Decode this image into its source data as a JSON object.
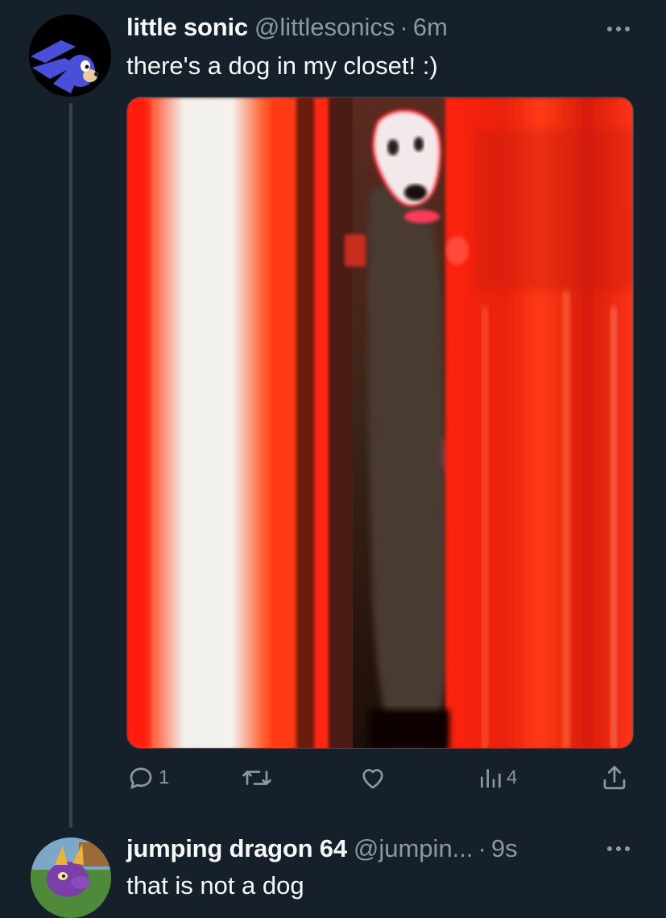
{
  "tweets": [
    {
      "display_name": "little sonic",
      "handle": "@littlesonics",
      "separator": "·",
      "time": "6m",
      "text": "there's a dog in my closet! :)",
      "actions": {
        "reply_count": "1",
        "retweet_count": "",
        "like_count": "",
        "views_count": "4"
      }
    },
    {
      "display_name": "jumping dragon 64",
      "handle": "@jumpin...",
      "separator": "·",
      "time": "9s",
      "text": "that is not a dog"
    }
  ],
  "colors": {
    "background": "#15202b",
    "text_primary": "#f7f9f9",
    "text_secondary": "#8b98a5",
    "thread_line": "#38444d"
  },
  "icons": {
    "more": "more-dots-icon",
    "reply": "reply-bubble-icon",
    "retweet": "retweet-icon",
    "like": "heart-icon",
    "views": "views-bars-icon",
    "share": "share-upload-icon"
  }
}
